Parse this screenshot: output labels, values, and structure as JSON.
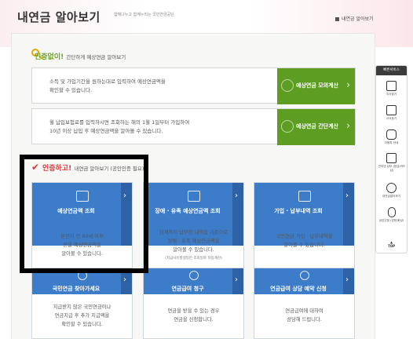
{
  "header": {
    "logo": "내연금 알아보기",
    "tagline": "함께나누고 함께누리는 국민연금공단",
    "link": "내연금 알아보기"
  },
  "section1": {
    "accent": "인증없이!",
    "title": "간단하게 예상연금 알아보기",
    "items": [
      {
        "text_line1": "소득 및 가입기간을 원하는대로 입력하여 예상연금액을",
        "text_line2": "확인할 수 있습니다.",
        "button": "예상연금 모의계산"
      },
      {
        "text_line1": "월 납입보험료를 입력하시면 조회하는 해의 1월 1일부터 가입하여",
        "text_line2": "10년 이상 납입 후 예상연금액을 알아볼 수 있습니다.",
        "button": "예상연금 간단계산"
      }
    ]
  },
  "section2": {
    "accent": "인증하고!",
    "title": "내연금 알아보기 (공인인증 필요)",
    "cards": [
      {
        "title": "예상연금액 조회",
        "lines": [
          "본인이 만 60세 이후",
          "받을 예상연금액을",
          "알아볼 수 있습니다."
        ],
        "note": ""
      },
      {
        "title": "장애 · 유족 예상연금액 조회",
        "lines": [
          "현재까지 납부한 내역을 기준으로",
          "장애 · 유족 예상연금액을",
          "알아볼 수 있습니다."
        ],
        "note": "(지금사유발생일은 조회일로 자동계산)"
      },
      {
        "title": "가입 · 납부내역 조회",
        "lines": [
          "국민연금 가입 · 납부내역을",
          "알아볼 수 있습니다."
        ],
        "note": ""
      },
      {
        "title": "국민연금 찾아가세요",
        "lines": [
          "지급받지 않은 국민연금이나",
          "연금지급 후 추가 지급액을",
          "확인할 수 있습니다."
        ],
        "note": ""
      },
      {
        "title": "연금급여 청구",
        "lines": [
          "연금을 받을 수 있는 경우",
          "연금을 신청합니다."
        ],
        "note": ""
      },
      {
        "title": "연금급여 상담 예약 신청",
        "lines": [
          "연금급여에 대하여",
          "상담해 드립니다."
        ],
        "note": ""
      }
    ]
  },
  "quick_menu": {
    "title": "빠른서비스",
    "items": [
      {
        "label": "지사찾기",
        "icon": "building-icon"
      },
      {
        "label": "서식찾기",
        "icon": "document-search-icon"
      },
      {
        "label": "이용자 안내",
        "icon": "speech-bubble-icon"
      },
      {
        "label": "인터넷 납부 (현금/카드 납)",
        "icon": "monitor-icon"
      },
      {
        "label": "내연금알아보기",
        "icon": "pinwheel-icon"
      },
      {
        "label": "상담신청 (방문/화상)",
        "icon": "mouse-icon"
      }
    ],
    "top": "TOP"
  },
  "colors": {
    "green": "#5d9e22",
    "blue": "#3d7cc9",
    "blue_dark": "#2e62a6",
    "accent_red": "#d63b3b"
  }
}
